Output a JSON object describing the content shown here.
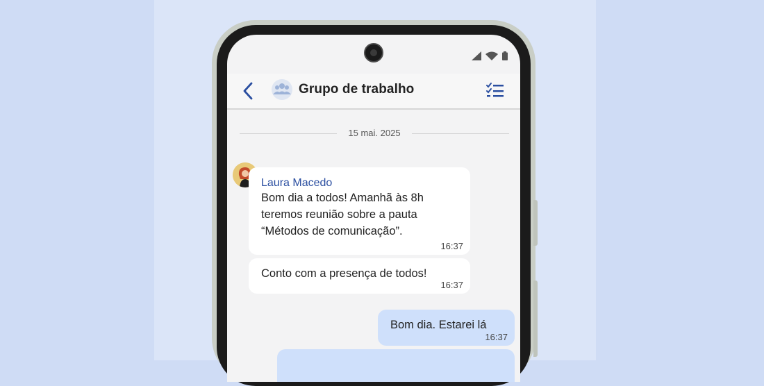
{
  "chat": {
    "title": "Grupo de trabalho",
    "date_separator": "15 mai. 2025"
  },
  "messages": [
    {
      "sender": "Laura Macedo",
      "text": "Bom dia a todos! Amanhã às 8h\nteremos reunião sobre a pauta\n“Métodos de comunicação”.",
      "time": "16:37"
    },
    {
      "text": "Conto com a presença de todos!",
      "time": "16:37"
    },
    {
      "text": "Bom dia. Estarei lá",
      "time": "16:37"
    }
  ],
  "icons": {
    "back": "chevron-left-icon",
    "group": "group-icon",
    "checklist": "checklist-icon",
    "signal": "signal-icon",
    "wifi": "wifi-icon",
    "battery": "battery-icon"
  },
  "colors": {
    "background": "#cfdcf5",
    "accent": "#2a4ea0",
    "outgoing_bubble": "#cfe0fb",
    "incoming_bubble": "#ffffff"
  }
}
